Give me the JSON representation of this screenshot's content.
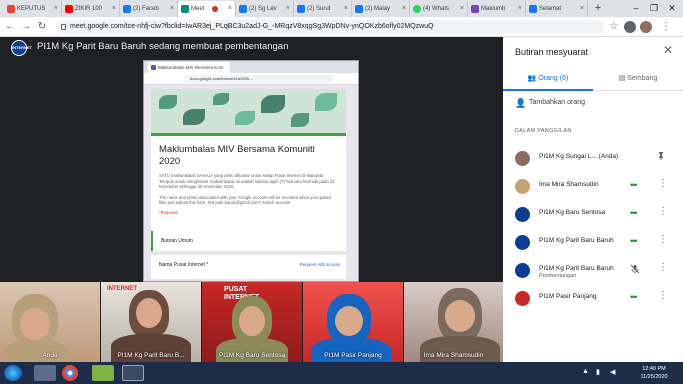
{
  "browser": {
    "tabs": [
      {
        "label": "KEPUTUS",
        "color": "#ea4335"
      },
      {
        "label": "ZIKIR 100",
        "color": "#ff0000"
      },
      {
        "label": "(2) Faceb",
        "color": "#1877f2"
      },
      {
        "label": "Meet",
        "color": "#00897b"
      },
      {
        "label": "(2) Sg Lev",
        "color": "#1877f2"
      },
      {
        "label": "(2) Surut",
        "color": "#1877f2"
      },
      {
        "label": "(2) Malay",
        "color": "#1877f2"
      },
      {
        "label": "(4) Whats",
        "color": "#25d366"
      },
      {
        "label": "Maklumb",
        "color": "#7248b9"
      },
      {
        "label": "Selamat",
        "color": "#1877f2"
      }
    ],
    "url": "meet.google.com/tce-nhfj-ciw?fbclid=IwAR3ej_PLqBC3u2adJ-G_-MRqzV8xqgSg3WpDNv-ynQOKzb6ofly02MQzwuQ"
  },
  "meet": {
    "presenter_avatar": "INTERNET",
    "presenting_title": "PI1M Kg Parit Baru Baruh sedang membuat pembentangan"
  },
  "shared": {
    "tab_label": "Maklumbalas MIV Bersama Kom",
    "url": "docs.google.com/forms/d/1aO8Sr...",
    "form_title": "Maklumbalas MIV Bersama Komuniti 2020",
    "form_desc": "SATU maklumbalas SAHAJA yang perlu dihantar untuk setiap Pusat Internet di Malaysia. Tempoh untuk menghantar maklumbalas ini adalah selama tujuh (7) hari iaitu bermula pada 24 November sehingga 30 November 2020.",
    "form_note": "The name and photo associated with your Google Account will be recorded when you upload files and submit this form. Not parit.baruh@gmail.com? Switch account",
    "required": "*Required",
    "section": "Butiran Umum",
    "field": "Nama Pusat Internet *",
    "edit_access": "Request edit access"
  },
  "filmstrip": [
    {
      "name": "Anda"
    },
    {
      "name": "PI1M Kg Parit Baru B..."
    },
    {
      "name": "PI1M Kg Baru Sentosa"
    },
    {
      "name": "PI1M Pasir Panjang"
    },
    {
      "name": "Ima Mira Shamsudin"
    }
  ],
  "posters": {
    "pusat": "PUSAT",
    "internet": "INTERNET"
  },
  "panel": {
    "title": "Butiran mesyuarat",
    "tab_people": "Orang (6)",
    "tab_chat": "Sembang",
    "add_people": "Tambahkan orang",
    "in_call": "DALAM PANGGILAN",
    "people": [
      {
        "name": "PI1M Kg Sungai L...",
        "suffix": "(Anda)",
        "sub": "",
        "avatar": "#8d6e63"
      },
      {
        "name": "Ima Mira Shamsudin",
        "suffix": "",
        "sub": "",
        "avatar": "#c5a572"
      },
      {
        "name": "PI1M Kg Baru Sentosa",
        "suffix": "",
        "sub": "",
        "avatar": "#0b3d91"
      },
      {
        "name": "PI1M Kg Parit Baru Baruh",
        "suffix": "",
        "sub": "",
        "avatar": "#0b3d91"
      },
      {
        "name": "PI1M Kg Parit Baru Baruh",
        "suffix": "",
        "sub": "Pembentangan",
        "avatar": "#0b3d91"
      },
      {
        "name": "PI1M Pasir Panjang",
        "suffix": "",
        "sub": "",
        "avatar": "#c62828"
      }
    ]
  },
  "taskbar": {
    "time": "12:40 PM",
    "date": "11/25/2020"
  },
  "colors": {
    "accent": "#1a73e8",
    "meet_bg": "#202124",
    "active_dots": "#1e8e3e"
  }
}
